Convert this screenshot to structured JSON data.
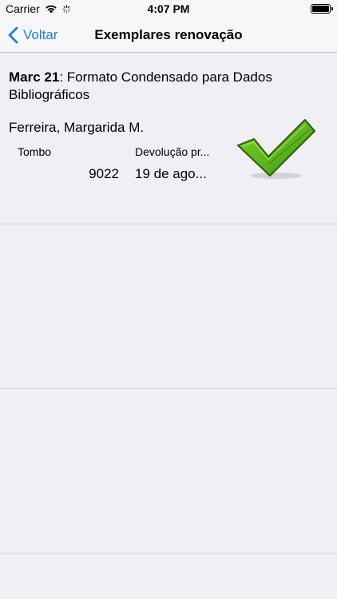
{
  "status_bar": {
    "carrier": "Carrier",
    "time": "4:07 PM"
  },
  "nav": {
    "back_label": "Voltar",
    "title": "Exemplares renovação"
  },
  "item": {
    "title_bold": "Marc 21",
    "title_rest": ": Formato Condensado para Dados Bibliográficos",
    "author": "Ferreira, Margarida M.",
    "col_tombo_label": "Tombo",
    "col_devolucao_label": "Devolução pr...",
    "tombo_value": "9022",
    "devolucao_value": "19 de ago...",
    "status_icon": "checkmark-icon",
    "status_color": "#5fb81a"
  }
}
